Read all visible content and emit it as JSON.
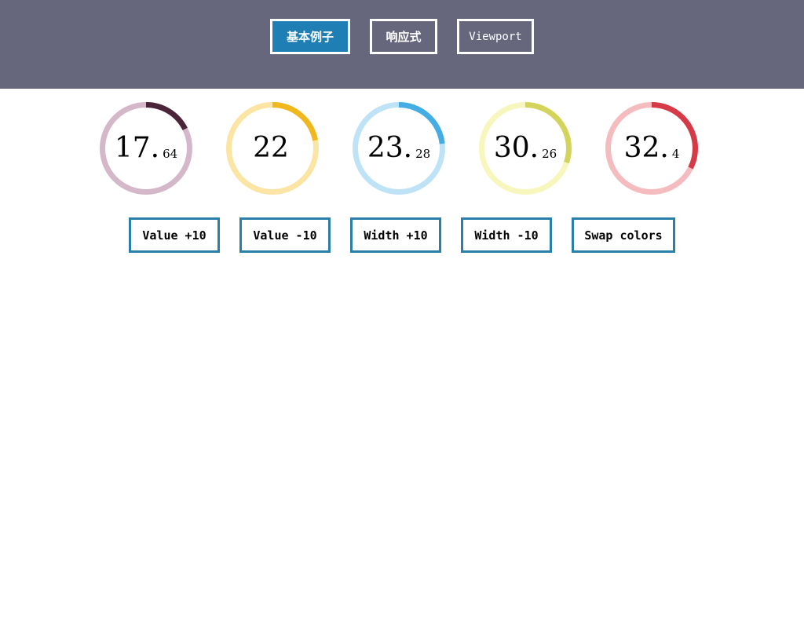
{
  "nav": {
    "tabs": [
      {
        "label": "基本例子",
        "active": true
      },
      {
        "label": "响应式",
        "active": false
      },
      {
        "label": "Viewport",
        "active": false
      }
    ]
  },
  "gauges": [
    {
      "int": "17.",
      "frac": "64",
      "value": 17.64,
      "track_color": "#d4b8c9",
      "fill_color": "#4a2438"
    },
    {
      "int": "22",
      "frac": "",
      "value": 22,
      "track_color": "#fbe4a4",
      "fill_color": "#f0b81c"
    },
    {
      "int": "23.",
      "frac": "28",
      "value": 23.28,
      "track_color": "#bfe3f6",
      "fill_color": "#44aee4"
    },
    {
      "int": "30.",
      "frac": "26",
      "value": 30.26,
      "track_color": "#f7f7bd",
      "fill_color": "#d4d45c"
    },
    {
      "int": "32.",
      "frac": "4",
      "value": 32.4,
      "track_color": "#f5bcbf",
      "fill_color": "#d53a46"
    }
  ],
  "controls": {
    "value_plus": "Value +10",
    "value_minus": "Value -10",
    "width_plus": "Width +10",
    "width_minus": "Width -10",
    "swap": "Swap colors"
  },
  "colors": {
    "header_bg": "#66667c",
    "active_tab": "#1f7fb4",
    "control_border": "#2a7fa8"
  }
}
